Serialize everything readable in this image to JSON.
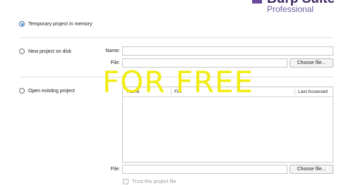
{
  "brand": {
    "product_name": "Burp Suite",
    "edition": "Professional"
  },
  "options": {
    "temporary": {
      "label": "Temporary project in memory",
      "selected": true
    },
    "new_project": {
      "label": "New project on disk",
      "name_label": "Name:",
      "name_value": "",
      "file_label": "File:",
      "file_value": "",
      "choose_file": "Choose file..."
    },
    "open_existing": {
      "label": "Open existing project",
      "columns": [
        "Name",
        "File",
        "Last Accessed"
      ],
      "rows": [],
      "file_label": "File:",
      "file_value": "",
      "choose_file": "Choose file...",
      "trust_label": "Trust this project file"
    }
  },
  "watermark": {
    "text": "FOR FREE",
    "color": "#f2ec12"
  },
  "colors": {
    "accent": "#2d6fb5",
    "brand": "#3e2a63"
  }
}
